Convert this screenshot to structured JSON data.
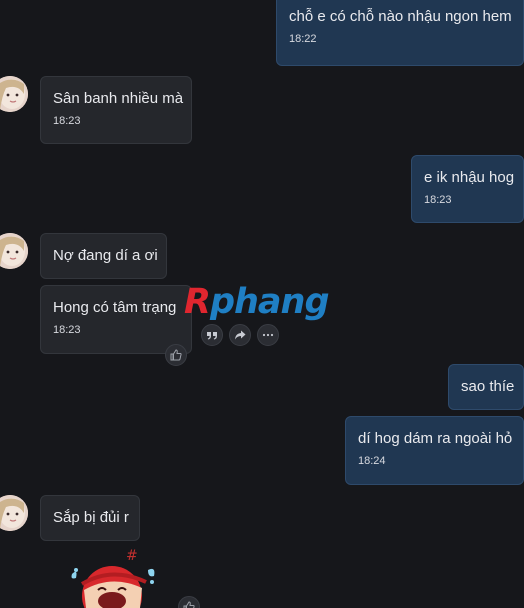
{
  "watermark": {
    "first": "R",
    "rest": "phang"
  },
  "messages": [
    {
      "id": "m1",
      "side": "out",
      "text": "chỗ e có chỗ nào nhậu ngon hem",
      "time": "18:22"
    },
    {
      "id": "m2",
      "side": "in",
      "text": "Sân banh nhiều mà",
      "time": "18:23"
    },
    {
      "id": "m3",
      "side": "out",
      "text": "e ik nhậu hog",
      "time": "18:23"
    },
    {
      "id": "m4",
      "side": "in",
      "text": "Nợ đang dí a ơi"
    },
    {
      "id": "m5",
      "side": "in",
      "text": "Hong có tâm trạng",
      "time": "18:23"
    },
    {
      "id": "m6",
      "side": "out",
      "text": "sao thíe"
    },
    {
      "id": "m7",
      "side": "out",
      "text": "dí hog dám ra ngoài hỏ",
      "time": "18:24"
    },
    {
      "id": "m8",
      "side": "in",
      "text": "Sắp bị đủi r"
    }
  ],
  "hover_actions": [
    "quote-icon",
    "forward-icon",
    "more-icon"
  ],
  "like_icon": "thumbs-up-icon",
  "colors": {
    "background": "#16171b",
    "outgoing_bubble": "#203752",
    "incoming_bubble": "#25272c",
    "text": "#e9eaee"
  }
}
